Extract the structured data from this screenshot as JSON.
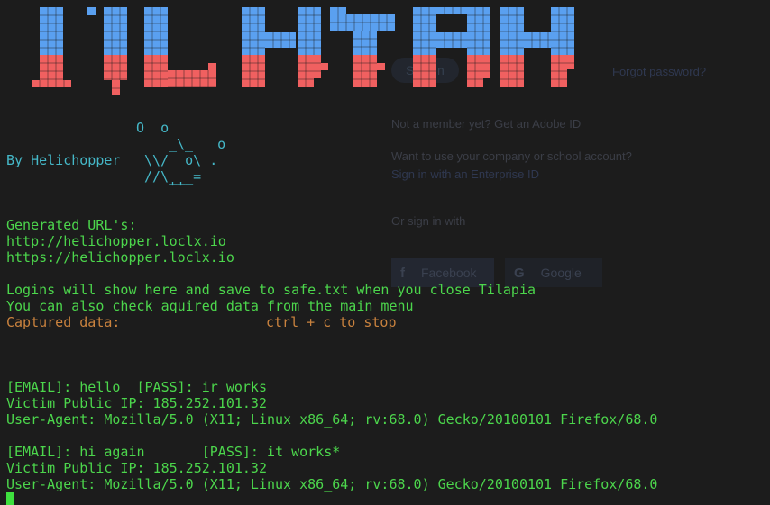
{
  "background_page": {
    "sign_in_button": "Sign in",
    "forgot_password": "Forgot password?",
    "not_member": "Not a member yet? Get an Adobe ID",
    "want_company": "Want to use your company or school account?",
    "enterprise_link": "Sign in with an Enterprise ID",
    "or_sign_in": "Or sign in with",
    "facebook": "Facebook",
    "google": "Google"
  },
  "banner": {
    "colors": {
      "top": "#5aa0f0",
      "bottom": "#f06060"
    },
    "block_letters": "ILHTPH"
  },
  "credit": {
    "art_line1": "O  o",
    "art_line2": "_\\_   o",
    "by_text": "By Helichopper",
    "art_line3": "\\\\/  o\\ .",
    "art_line4": "//\\___=",
    "art_line5": "''"
  },
  "terminal": {
    "generated_heading": "Generated URL's:",
    "url_http": "http://helichopper.loclx.io",
    "url_https": "https://helichopper.loclx.io",
    "logins_note": "Logins will show here and save to safe.txt when you close Tilapia",
    "menu_note": "You can also check aquired data from the main menu",
    "captured_label": "Captured data:",
    "stop_hint": "ctrl + c to stop",
    "entries": [
      {
        "creds": "[EMAIL]: hello  [PASS]: ir works",
        "ip": "Victim Public IP: 185.252.101.32",
        "ua": "User-Agent: Mozilla/5.0 (X11; Linux x86_64; rv:68.0) Gecko/20100101 Firefox/68.0"
      },
      {
        "creds": "[EMAIL]: hi again       [PASS]: it works*",
        "ip": "Victim Public IP: 185.252.101.32",
        "ua": "User-Agent: Mozilla/5.0 (X11; Linux x86_64; rv:68.0) Gecko/20100101 Firefox/68.0"
      }
    ]
  },
  "colors": {
    "terminal_bg": "#1c1c1c",
    "green_text": "#4cd64c",
    "cyan_text": "#45b8c8",
    "orange_text": "#c9823e",
    "cursor": "#3ee03e"
  }
}
